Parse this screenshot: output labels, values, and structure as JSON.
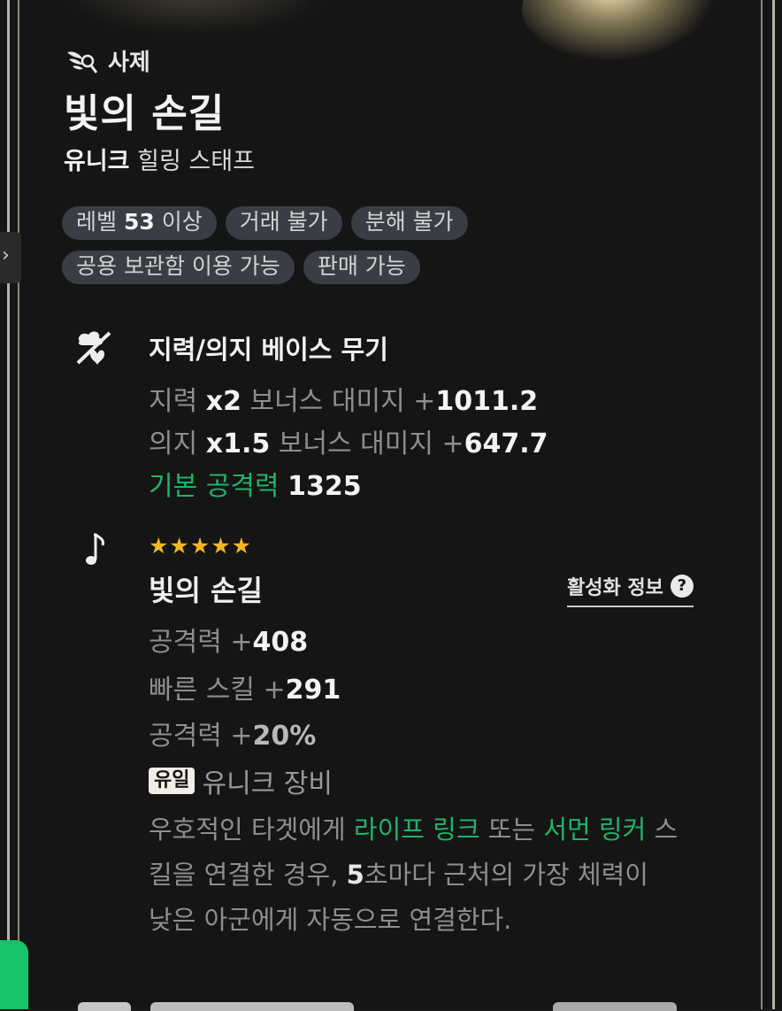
{
  "header": {
    "class_icon": "sage-wings-icon",
    "class_name": "사제",
    "item_name": "빛의 손길",
    "grade": "유니크",
    "item_type": "힐링 스태프"
  },
  "tags": {
    "level_prefix": "레벨",
    "level_value": "53",
    "level_suffix": "이상",
    "items": [
      "거래 불가",
      "분해 불가",
      "공용 보관함 이용 가능",
      "판매 가능"
    ]
  },
  "base_section": {
    "icon": "weapon-base-icon",
    "title": "지력/의지 베이스 무기",
    "lines": [
      {
        "label": "지력",
        "mult": "x2",
        "middle": "보너스 대미지",
        "plus": "+",
        "value": "1011.2"
      },
      {
        "label": "의지",
        "mult": "x1.5",
        "middle": "보너스 대미지",
        "plus": "+",
        "value": "647.7"
      }
    ],
    "base_attack_label": "기본 공격력",
    "base_attack_value": "1325"
  },
  "set_section": {
    "icon": "music-note-icon",
    "stars": "★★★★★",
    "star_count": 5,
    "name": "빛의 손길",
    "activation_info": "활성화 정보",
    "stats": [
      {
        "label": "공격력",
        "plus": "+",
        "value": "408"
      },
      {
        "label": "빠른 스킬",
        "plus": "+",
        "value": "291"
      },
      {
        "label": "공격력",
        "plus": "+",
        "value": "20%"
      }
    ],
    "unique_badge": "유일",
    "unique_text": "유니크 장비",
    "desc": {
      "p1": "우호적인 타겟에게 ",
      "g1": "라이프 링크",
      "p2": " 또는 ",
      "g2": "서먼 링커",
      "p3": " 스킬을 연결한 경우, ",
      "num": "5",
      "p4": "초마다 근처의 가장 체력이 낮은 아군에게 자동으로 연결한다."
    }
  },
  "colors": {
    "accent_green": "#20b36a",
    "star": "#f4b625",
    "tag_bg": "#3a3d44"
  }
}
